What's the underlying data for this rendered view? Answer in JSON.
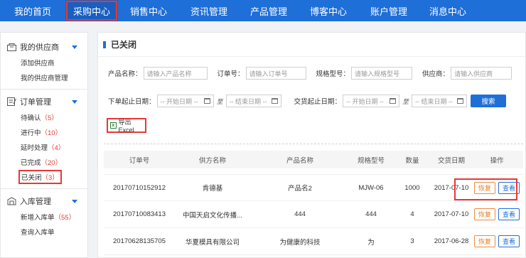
{
  "nav": {
    "items": [
      "我的首页",
      "采购中心",
      "销售中心",
      "资讯管理",
      "产品管理",
      "博客中心",
      "账户管理",
      "消息中心"
    ],
    "active": "采购中心"
  },
  "sidebar": {
    "groups": [
      {
        "label": "我的供应商",
        "icon": "supplier-icon",
        "items": [
          {
            "label": "添加供应商",
            "count": ""
          },
          {
            "label": "我的供应商管理",
            "count": ""
          }
        ]
      },
      {
        "label": "订单管理",
        "icon": "order-icon",
        "items": [
          {
            "label": "待确认",
            "count": "（5）"
          },
          {
            "label": "进行中",
            "count": "（10）"
          },
          {
            "label": "延时处理",
            "count": "（4）"
          },
          {
            "label": "已完成",
            "count": "（20）"
          },
          {
            "label": "已关闭",
            "count": "（3）"
          }
        ]
      },
      {
        "label": "入库管理",
        "icon": "warehouse-icon",
        "items": [
          {
            "label": "新增入库单",
            "count": "（55）"
          },
          {
            "label": "查询入库单",
            "count": ""
          }
        ]
      }
    ]
  },
  "main": {
    "title": "已关闭",
    "filters": {
      "product_name_label": "产品名称：",
      "product_name_placeholder": "请输入产品名称",
      "order_no_label": "订单号：",
      "order_no_placeholder": "请输入订单号",
      "spec_label": "规格型号：",
      "spec_placeholder": "请输入规格型号",
      "supplier_label": "供应商：",
      "supplier_placeholder": "请输入供应商",
      "order_date_label": "下单起止日期：",
      "delivery_date_label": "交货起止日期：",
      "start_placeholder": "-- 开始日期 --",
      "end_placeholder": "-- 结束日期 --",
      "to": "至",
      "search_label": "搜索"
    },
    "export_label": "导出Excel",
    "table": {
      "headers": [
        "订单号",
        "供方名称",
        "产品名称",
        "规格型号",
        "数量",
        "交货日期",
        "操作"
      ],
      "rows": [
        [
          "20170710152912",
          "肯德基",
          "产品名2",
          "MJW-06",
          "1000",
          "2017-07-10"
        ],
        [
          "20170710083413",
          "中国天启文化传播...",
          "444",
          "444",
          "4",
          "2017-07-10"
        ],
        [
          "20170628135705",
          "华夏模具有限公司",
          "为健康的科技",
          "为",
          "3",
          "2017-06-28"
        ]
      ],
      "restore_label": "恢复",
      "view_label": "查看"
    }
  }
}
